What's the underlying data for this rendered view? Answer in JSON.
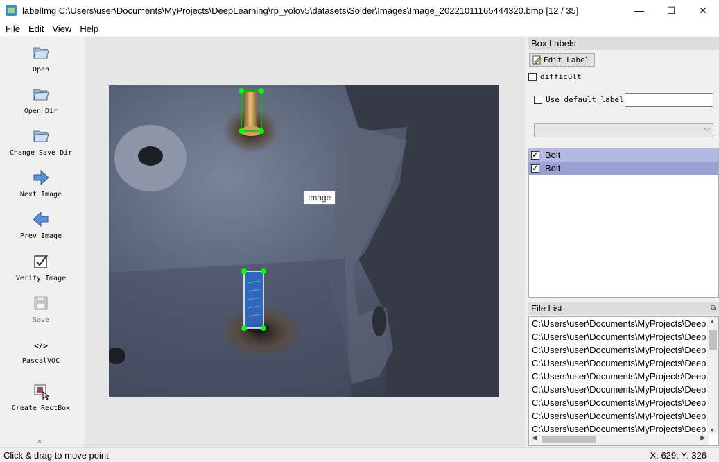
{
  "window": {
    "title": "labelImg C:\\Users\\user\\Documents\\MyProjects\\DeepLearning\\rp_yolov5\\datasets\\Solder\\Images\\Image_20221011165444320.bmp [12 / 35]",
    "minimize": "—",
    "maximize": "☐",
    "close": "✕"
  },
  "menu": [
    "File",
    "Edit",
    "View",
    "Help"
  ],
  "toolbar": {
    "open": "Open",
    "open_dir": "Open Dir",
    "change_save_dir": "Change Save Dir",
    "next_image": "Next Image",
    "prev_image": "Prev Image",
    "verify_image": "Verify Image",
    "save": "Save",
    "format_icon": "</>",
    "format": "PascalVOC",
    "create_rectbox": "Create RectBox",
    "more": "»"
  },
  "canvas": {
    "tooltip": "Image",
    "boxes": [
      {
        "label": "Bolt",
        "color": "#00c800"
      },
      {
        "label": "Bolt",
        "color": "#1e5bd6"
      }
    ]
  },
  "box_labels": {
    "title": "Box Labels",
    "edit_label": "Edit Label",
    "difficult": "difficult",
    "use_default_label": "Use default label",
    "default_value": "",
    "items": [
      {
        "label": "Bolt",
        "checked": true
      },
      {
        "label": "Bolt",
        "checked": true
      }
    ]
  },
  "file_list": {
    "title": "File List",
    "float_icon": "⧉",
    "files": [
      "C:\\Users\\user\\Documents\\MyProjects\\DeepLearning",
      "C:\\Users\\user\\Documents\\MyProjects\\DeepLearning",
      "C:\\Users\\user\\Documents\\MyProjects\\DeepLearning",
      "C:\\Users\\user\\Documents\\MyProjects\\DeepLearning",
      "C:\\Users\\user\\Documents\\MyProjects\\DeepLearning",
      "C:\\Users\\user\\Documents\\MyProjects\\DeepLearning",
      "C:\\Users\\user\\Documents\\MyProjects\\DeepLearning",
      "C:\\Users\\user\\Documents\\MyProjects\\DeepLearning",
      "C:\\Users\\user\\Documents\\MyProjects\\DeepLearning"
    ]
  },
  "status": {
    "message": "Click & drag to move point",
    "coords": "X: 629; Y: 326"
  }
}
